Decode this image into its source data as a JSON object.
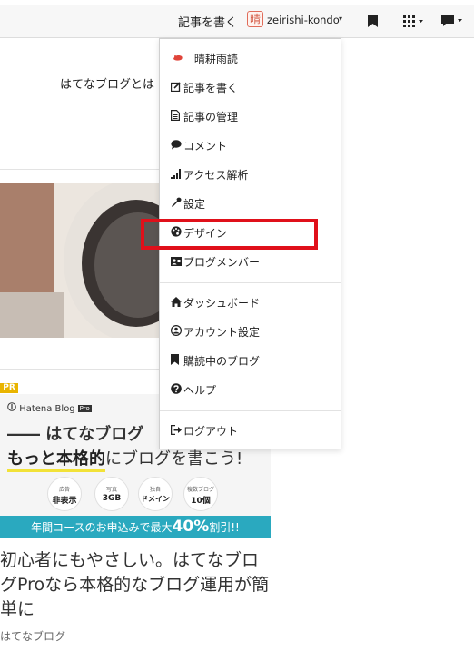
{
  "topbar": {
    "write_label": "記事を書く",
    "avatar_char": "晴",
    "username": "zeirishi-kondo",
    "caret": "▾",
    "icons": [
      "bookmark-icon",
      "grid-icon",
      "chat-icon"
    ]
  },
  "main": {
    "about_link": "はてなブログとは"
  },
  "ad": {
    "pr_badge": "PR",
    "logo_text": "Hatena Blog",
    "logo_pro": "Pro",
    "headline": "―― はてなブログ",
    "subline_bold": "もっと本格的",
    "subline_rest": "にブログを書こう!",
    "features": [
      {
        "small": "広告",
        "large": "非表示"
      },
      {
        "small": "写真",
        "large": "3GB"
      },
      {
        "small": "独自",
        "large": "ドメイン"
      },
      {
        "small": "複数ブログ",
        "large": "10個"
      }
    ],
    "band_prefix": "年間コースのお申込みで最大",
    "band_big": "40%",
    "band_suffix": "割引!!"
  },
  "article": {
    "caption": "初心者にもやさしい。はてなブログProなら本格的なブログ運用が簡単に",
    "source": "はてなブログ"
  },
  "menu": {
    "items": [
      {
        "label": "晴耕雨読",
        "icon": "blog-icon"
      },
      {
        "label": "記事を書く",
        "icon": "edit-icon"
      },
      {
        "label": "記事の管理",
        "icon": "document-icon"
      },
      {
        "label": "コメント",
        "icon": "comment-icon"
      },
      {
        "label": "アクセス解析",
        "icon": "signal-icon"
      },
      {
        "label": "設定",
        "icon": "wrench-icon"
      },
      {
        "label": "デザイン",
        "icon": "palette-icon"
      },
      {
        "label": "ブログメンバー",
        "icon": "members-icon"
      },
      {
        "label": "ダッシュボード",
        "icon": "home-icon"
      },
      {
        "label": "アカウント設定",
        "icon": "user-circle-icon"
      },
      {
        "label": "購読中のブログ",
        "icon": "bookmark-icon"
      },
      {
        "label": "ヘルプ",
        "icon": "question-icon"
      },
      {
        "label": "ログアウト",
        "icon": "logout-icon"
      }
    ],
    "highlight_color": "#e0101a"
  }
}
